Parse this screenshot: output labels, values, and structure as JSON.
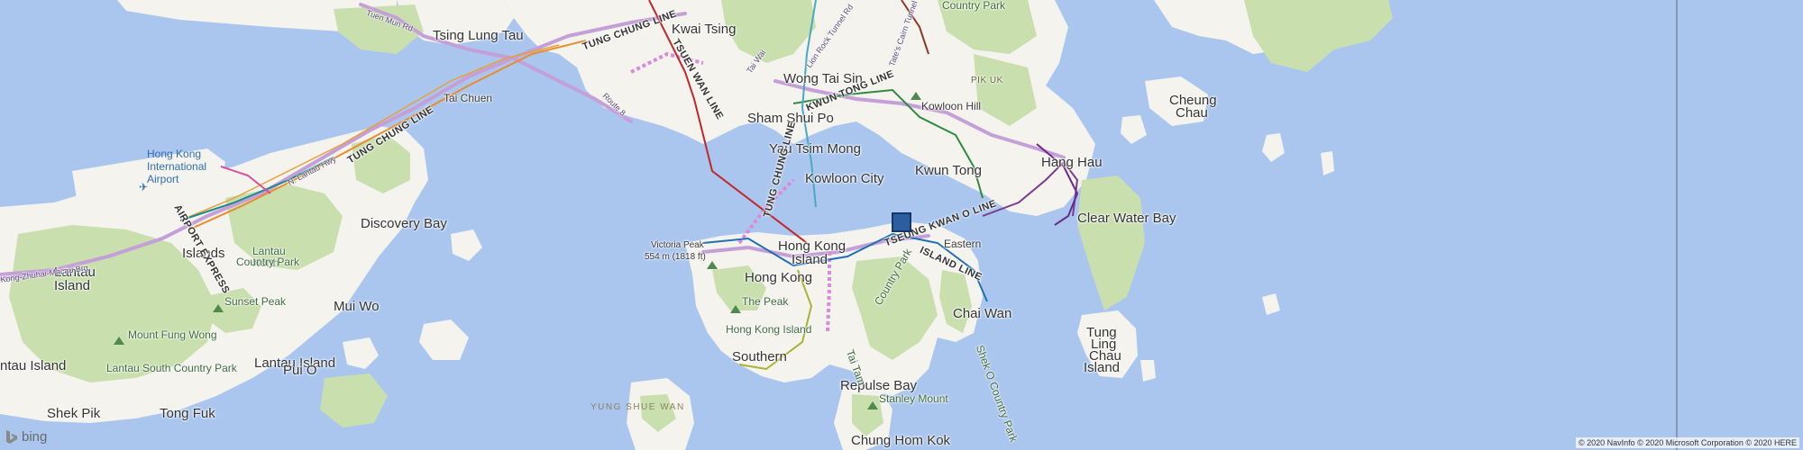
{
  "map": {
    "water_color": "#aac6ee",
    "land_color": "#f4f3ee",
    "park_color": "#c9dfae",
    "accent_color": "#2c5d9e"
  },
  "labels": {
    "kwai_tsing": "Kwai Tsing",
    "tsing_lung_tau": "Tsing Lung Tau",
    "tai_chuen": "Tai Chuen",
    "hk_airport_line1": "Hong Kong",
    "hk_airport_line2": "International",
    "hk_airport_line3": "Airport",
    "discovery_bay": "Discovery Bay",
    "islands": "Islands",
    "lantau_line1": "Lantau",
    "lantau_line2": "Island",
    "lantau_north_line1": "Lantau",
    "lantau_north_line2": "North",
    "lantau_north_line3": "Country Park",
    "sunset_peak": "Sunset Peak",
    "mui_wo": "Mui Wo",
    "mount_fung_wong": "Mount Fung Wong",
    "lantau_island": "Lantau Island",
    "lantau_island_left": "ntau Island",
    "lantau_south_cp": "Lantau South Country Park",
    "pui_o": "Pui O",
    "shek_pik": "Shek Pik",
    "tong_fuk": "Tong Fuk",
    "wong_tai_sin": "Wong Tai Sin",
    "sham_shui_po": "Sham Shui Po",
    "yau_tsim_mong": "Yau Tsim Mong",
    "kowloon_city": "Kowloon City",
    "kowloon_hill": "Kowloon Hill",
    "pik_uk": "PIK UK",
    "kwun_tong": "Kwun Tong",
    "hang_hau": "Hang Hau",
    "clear_water_bay": "Clear Water Bay",
    "cheung_chau_line1": "Cheung",
    "cheung_chau_line2": "Chau",
    "victoria_peak": "Victoria Peak",
    "victoria_peak_height": "554 m (1818 ft)",
    "hk_island_line1": "Hong Kong",
    "hk_island_line2": "Island",
    "hong_kong": "Hong Kong",
    "the_peak": "The Peak",
    "hong_kong_island": "Hong Kong Island",
    "southern": "Southern",
    "eastern": "Eastern",
    "chai_wan": "Chai Wan",
    "repulse_bay": "Repulse Bay",
    "stanley_mount": "Stanley Mount",
    "chung_hom_kok": "Chung Hom Kok",
    "yung_shue_wan": "YUNG SHUE WAN",
    "tung_ling_line1": "Tung",
    "tung_ling_line2": "Ling",
    "tung_ling_line3": "Chau",
    "tung_ling_line4": "Island",
    "tai_tam_cp": "Country Park",
    "tai_tam_prefix": "Tai Tam",
    "shek_o_cp": "Shek O Country Park",
    "country_park_top": "Country Park"
  },
  "lines": {
    "tung_chung_top": "TUNG CHUNG LINE",
    "tung_chung_mid": "TUNG CHUNG LINE",
    "tung_chung_island": "TUNG CHUNG LINE",
    "tsuen_wan": "TSUEN WAN LINE",
    "kwun_tong": "KWUN TONG LINE",
    "tseung_kwan_o": "TSEUNG KWAN O LINE",
    "island": "ISLAND LINE",
    "airport_express": "AIRPORT EXPRESS",
    "tai_wai": "Tai Wai"
  },
  "roads": {
    "tuen_mun_rd": "Tuen Mun Rd",
    "route_8": "Route 8",
    "n_lantau_hwy": "N. Lantau Hwy",
    "hk_zhuhai_macau": "Kong-Zhuhai-Macau Brg",
    "lion_rock": "Lion Rock Tunnel Rd",
    "eastern": "Tate's Cairn Tunnel"
  },
  "branding": {
    "logo_text": "bing",
    "copyright": "© 2020 NavInfo © 2020 Microsoft Corporation © 2020 HERE"
  },
  "icons": {
    "airport": "airplane-icon",
    "peak": "mountain-peak-icon",
    "logo": "bing-logo-icon"
  }
}
